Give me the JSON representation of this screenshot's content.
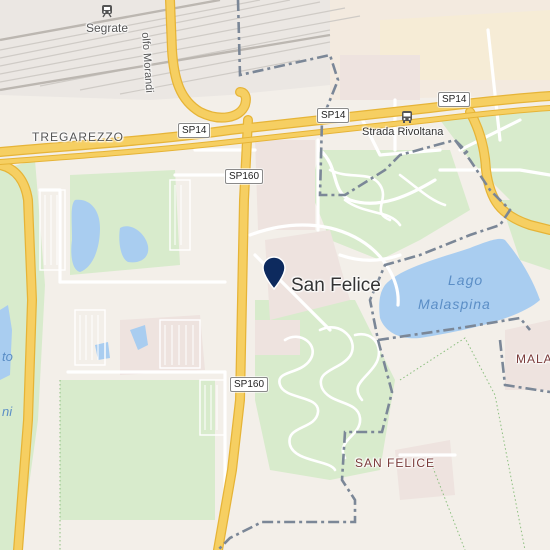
{
  "places": {
    "segrate": "Segrate",
    "tregarezzo": "TREGAREZZO",
    "strada_rivoltana": "Strada Rivoltana",
    "san_felice_main": "San Felice",
    "san_felice_district": "SAN FELICE",
    "lago_line1": "Lago",
    "lago_line2": "Malaspina",
    "mala": "MALA",
    "morandi": "olfo Morandi",
    "left_partial_1": "to",
    "left_partial_2": "ni"
  },
  "shields": {
    "sp14_left": "SP14",
    "sp14_mid": "SP14",
    "sp14_right": "SP14",
    "sp160_top": "SP160",
    "sp160_bottom": "SP160"
  },
  "icons": {
    "station_north": "train-station-icon",
    "station_east": "bus-station-icon",
    "marker": "location-pin-icon"
  },
  "colors": {
    "land": "#f3efe9",
    "park": "#d8ebcc",
    "water": "#a9cdf0",
    "water_label": "#5b8ec6",
    "major_road": "#f6cf62",
    "major_road_outline": "#e6b437",
    "minor_road": "#ffffff",
    "boundary": "#7b8797",
    "district_label": "#7a3b3a",
    "marker": "#0d2a5e",
    "rail": "#c9c6c2"
  }
}
